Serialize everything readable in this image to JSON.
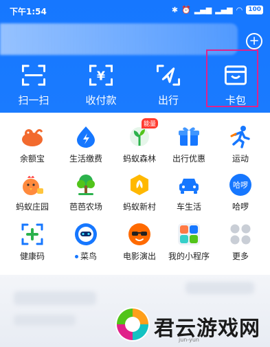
{
  "status_bar": {
    "time": "下午1:54",
    "battery": "100"
  },
  "quick_actions": [
    {
      "label": "扫一扫",
      "icon": "scan-icon"
    },
    {
      "label": "收付款",
      "icon": "payment-code-icon"
    },
    {
      "label": "出行",
      "icon": "navigation-arrow-icon"
    },
    {
      "label": "卡包",
      "icon": "wallet-card-icon"
    }
  ],
  "apps": [
    {
      "label": "余额宝",
      "icon": "yuebao-icon"
    },
    {
      "label": "生活缴费",
      "icon": "utility-bill-icon"
    },
    {
      "label": "蚂蚁森林",
      "icon": "ant-forest-icon",
      "badge": "能量"
    },
    {
      "label": "出行优惠",
      "icon": "travel-gift-icon"
    },
    {
      "label": "运动",
      "icon": "sports-icon"
    },
    {
      "label": "蚂蚁庄园",
      "icon": "ant-manor-icon"
    },
    {
      "label": "芭芭农场",
      "icon": "baba-farm-icon"
    },
    {
      "label": "蚂蚁新村",
      "icon": "ant-village-icon"
    },
    {
      "label": "车生活",
      "icon": "car-life-icon"
    },
    {
      "label": "哈啰",
      "icon": "hello-icon",
      "icon_text": "哈啰"
    },
    {
      "label": "健康码",
      "icon": "health-code-icon"
    },
    {
      "label": "菜鸟",
      "icon": "cainiao-icon"
    },
    {
      "label": "电影演出",
      "icon": "movie-show-icon"
    },
    {
      "label": "我的小程序",
      "icon": "mini-programs-icon"
    },
    {
      "label": "更多",
      "icon": "more-grid-icon"
    }
  ],
  "watermark": {
    "text": "君云游戏网",
    "sub": "jun-yun"
  },
  "colors": {
    "header_blue": "#1677ff",
    "highlight": "#e0218a"
  }
}
